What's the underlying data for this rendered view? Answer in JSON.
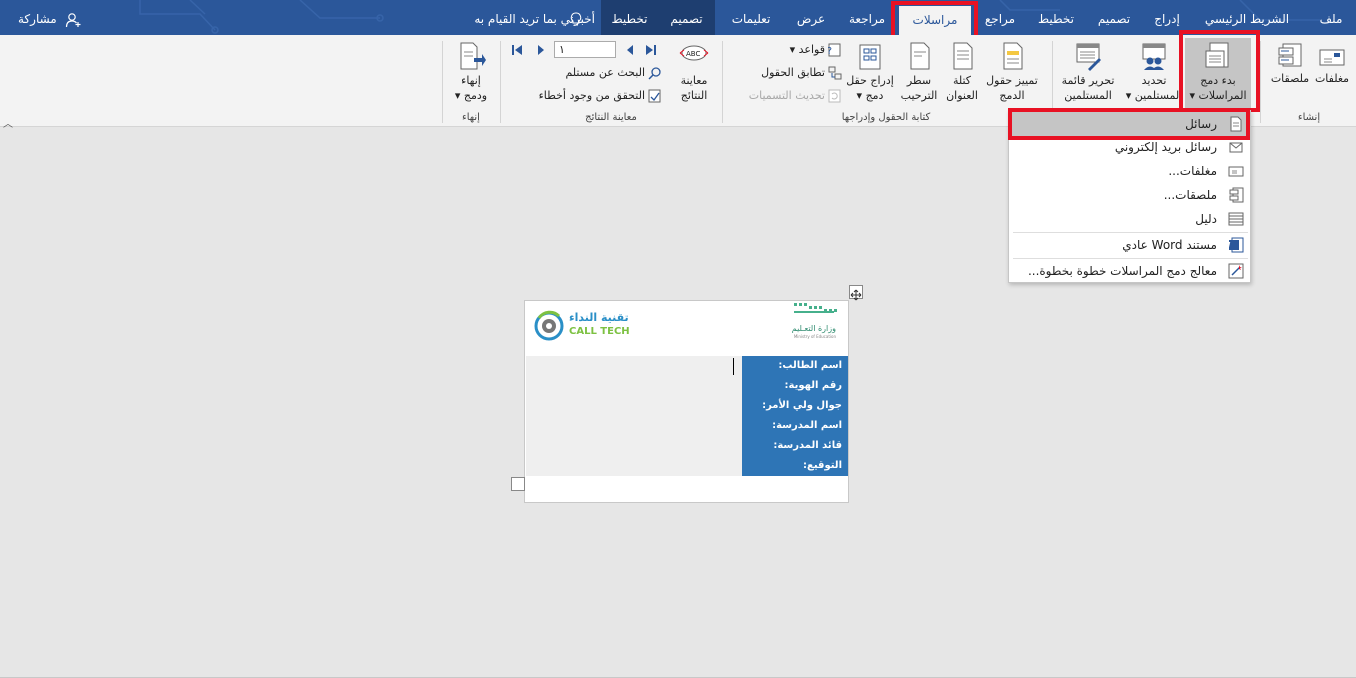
{
  "tabs": {
    "file": "ملف",
    "home": "الشريط الرئيسي",
    "insert": "إدراج",
    "design": "تصميم",
    "layout": "تخطيط",
    "references": "مراجع",
    "mailings": "مراسلات",
    "review": "مراجعة",
    "view": "عرض",
    "help": "تعليمات",
    "table_design": "تصميم",
    "table_layout": "تخطيط"
  },
  "tell_me": "أخبرني بما تريد القيام به",
  "share": "مشاركة",
  "ribbon": {
    "create": {
      "envelopes": "مغلفات",
      "labels": "ملصقات",
      "group_label": "إنشاء"
    },
    "start": {
      "start_merge_line1": "بدء دمج",
      "start_merge_line2": "المراسلات",
      "select_recipients_line1": "تحديد",
      "select_recipients_line2": "المستلمين",
      "edit_list_line1": "تحرير قائمة",
      "edit_list_line2": "المستلمين"
    },
    "fields": {
      "highlight_line1": "تمييز حقول",
      "highlight_line2": "الدمج",
      "address_line1": "كتلة",
      "address_line2": "العنوان",
      "greeting_line1": "سطر",
      "greeting_line2": "الترحيب",
      "insert_field_line1": "إدراج حقل",
      "insert_field_line2": "دمج",
      "rules": "قواعد",
      "match_fields": "تطابق الحقول",
      "update_labels": "تحديث التسميات",
      "group_label": "كتابة الحقول وإدراجها"
    },
    "preview": {
      "preview_line1": "معاينة",
      "preview_line2": "النتائج",
      "record_value": "١",
      "find_recipient": "البحث عن مستلم",
      "check_errors": "التحقق من وجود أخطاء",
      "group_label": "معاينة النتائج"
    },
    "finish": {
      "finish_line1": "إنهاء",
      "finish_line2": "ودمج",
      "group_label": "إنهاء"
    }
  },
  "dropdown": {
    "items": [
      {
        "label": "رسائل",
        "icon": "letter-icon"
      },
      {
        "label": "رسائل بريد إلكتروني",
        "icon": "email-icon"
      },
      {
        "label": "مغلفات...",
        "icon": "envelope-icon"
      },
      {
        "label": "ملصقات...",
        "icon": "labels-icon"
      },
      {
        "label": "دليل",
        "icon": "directory-icon"
      },
      {
        "label": "مستند Word عادي",
        "icon": "word-icon"
      },
      {
        "label": "معالج دمج المراسلات خطوة بخطوة...",
        "icon": "wizard-icon"
      }
    ]
  },
  "document": {
    "ministry_ar": "وزارة التعـليم",
    "ministry_en": "Ministry of Education",
    "company_ar": "تقنية النداء",
    "company_en": "CALL TECH",
    "fields": [
      "اسم الطالب:",
      "رقم الهوية:",
      "جوال ولي الأمر:",
      "اسم المدرسة:",
      "قائد المدرسة:",
      "التوقيع:"
    ]
  },
  "colors": {
    "tabbar": "#2b579a",
    "highlight": "#e81123",
    "panel": "#2e75b6"
  }
}
